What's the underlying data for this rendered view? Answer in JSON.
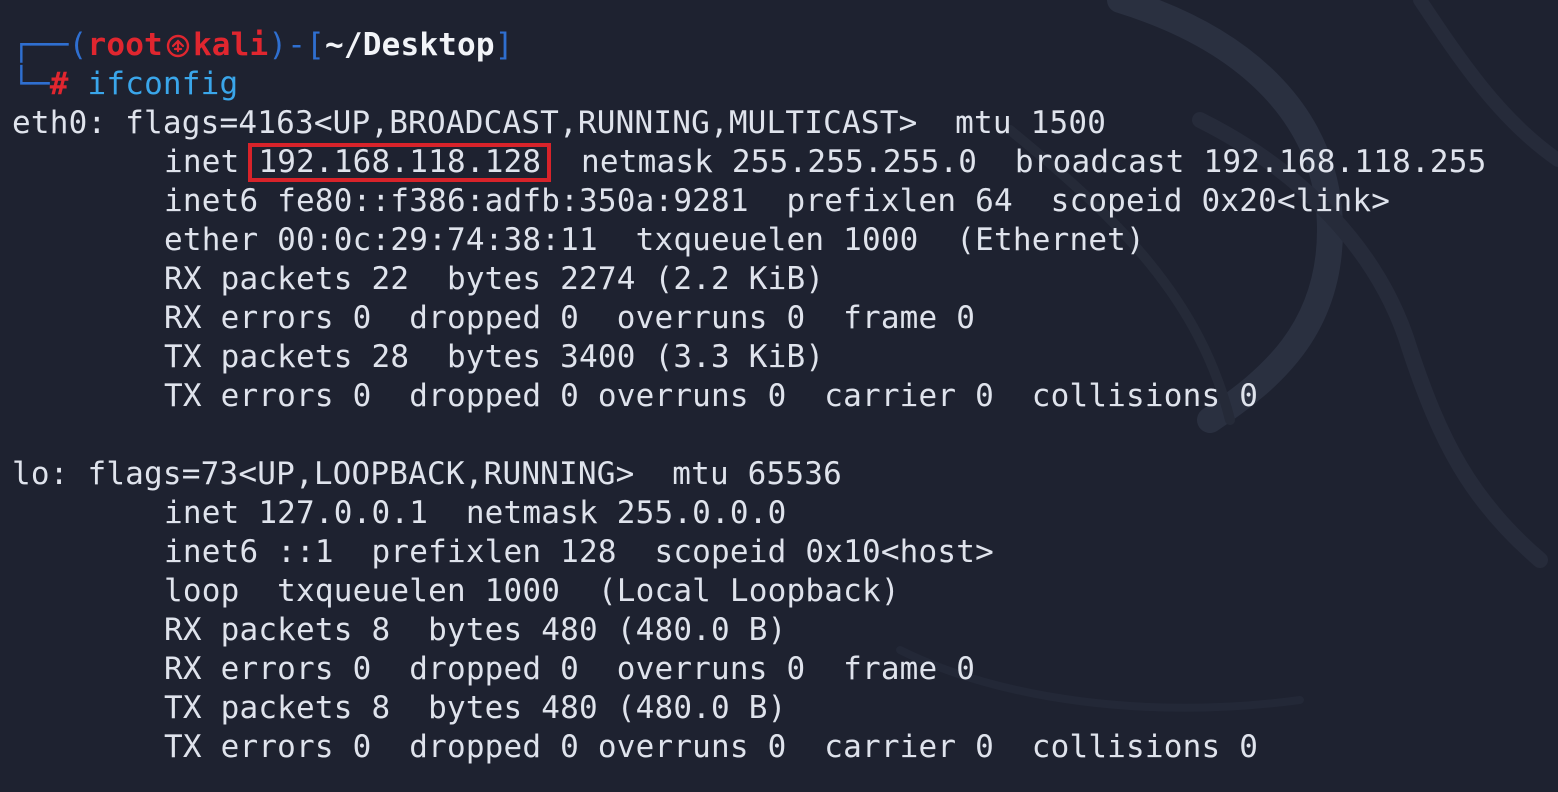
{
  "prompt": {
    "open_bracket": "┌──(",
    "user": "root",
    "host": "kali",
    "mid": ")-[",
    "path": "~/Desktop",
    "close_bracket": "]",
    "second_prefix": "└─",
    "hash": "#",
    "command": " ifconfig",
    "logo_icon": "kali-dragon-icon"
  },
  "eth0": {
    "header": "eth0: flags=4163<UP,BROADCAST,RUNNING,MULTICAST>  mtu 1500",
    "inet_label": "inet ",
    "inet_ip": "192.168.118.128",
    "inet_rest": "  netmask 255.255.255.0  broadcast 192.168.118.255",
    "lines": [
      "inet6 fe80::f386:adfb:350a:9281  prefixlen 64  scopeid 0x20<link>",
      "ether 00:0c:29:74:38:11  txqueuelen 1000  (Ethernet)",
      "RX packets 22  bytes 2274 (2.2 KiB)",
      "RX errors 0  dropped 0  overruns 0  frame 0",
      "TX packets 28  bytes 3400 (3.3 KiB)",
      "TX errors 0  dropped 0 overruns 0  carrier 0  collisions 0"
    ]
  },
  "lo": {
    "header": "lo: flags=73<UP,LOOPBACK,RUNNING>  mtu 65536",
    "lines": [
      "inet 127.0.0.1  netmask 255.0.0.0",
      "inet6 ::1  prefixlen 128  scopeid 0x10<host>",
      "loop  txqueuelen 1000  (Local Loopback)",
      "RX packets 8  bytes 480 (480.0 B)",
      "RX errors 0  dropped 0  overruns 0  frame 0",
      "TX packets 8  bytes 480 (480.0 B)",
      "TX errors 0  dropped 0 overruns 0  carrier 0  collisions 0"
    ]
  },
  "colors": {
    "background": "#1e2230",
    "text": "#dfe3ec",
    "prompt_box": "#2f6fd0",
    "user_host": "#e0262f",
    "command": "#3aa6ea",
    "highlight_box": "#d8232a"
  }
}
